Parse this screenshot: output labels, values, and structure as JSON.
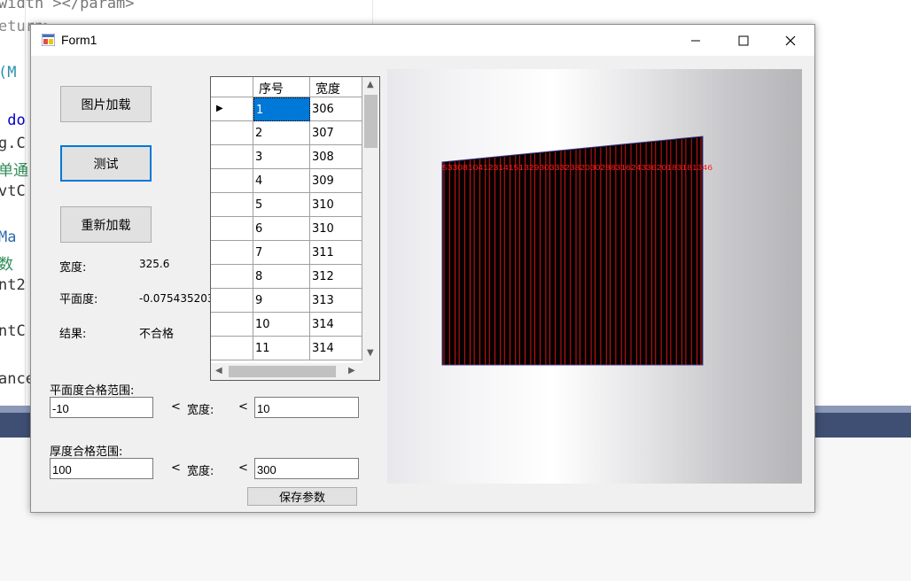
{
  "background_code": {
    "lines": [
      "width ></param>",
      "eturn>",
      "(M",
      " do",
      "g.C",
      "单通",
      "vtC",
      "Ma",
      "数",
      "nt2",
      "ntC",
      "ance"
    ]
  },
  "window": {
    "title": "Form1",
    "title_buttons": {
      "minimize": "—",
      "maximize": "☐",
      "close": "✕"
    }
  },
  "buttons": {
    "load_image": "图片加载",
    "test": "测试",
    "reload": "重新加载",
    "save_params": "保存参数"
  },
  "results": {
    "width_label": "宽度:",
    "width_value": "325.6",
    "flatness_label": "平面度:",
    "flatness_value": "-0.075435203",
    "result_label": "结果:",
    "result_value": "不合格"
  },
  "grid": {
    "columns": [
      "序号",
      "宽度"
    ],
    "rows": [
      [
        "1",
        "306"
      ],
      [
        "2",
        "307"
      ],
      [
        "3",
        "308"
      ],
      [
        "4",
        "309"
      ],
      [
        "5",
        "310"
      ],
      [
        "6",
        "310"
      ],
      [
        "7",
        "311"
      ],
      [
        "8",
        "312"
      ],
      [
        "9",
        "313"
      ],
      [
        "10",
        "314"
      ],
      [
        "11",
        "314"
      ]
    ],
    "selected_row": 0
  },
  "params": {
    "flatness_range_label": "平面度合格范围:",
    "flatness_min": "-10",
    "lt1": "<",
    "mid_label": "宽度:",
    "lt2": "<",
    "flatness_max": "10",
    "thickness_range_label": "厚度合格范围:",
    "thickness_min": "100",
    "lt3": "<",
    "mid_label2": "宽度:",
    "lt4": "<",
    "thickness_max": "300"
  },
  "picture": {
    "overlay_text": "53308104123141513293033323820302883162433620183181346",
    "line_color": "#ff1a1a",
    "shape_fill": "#050000"
  }
}
